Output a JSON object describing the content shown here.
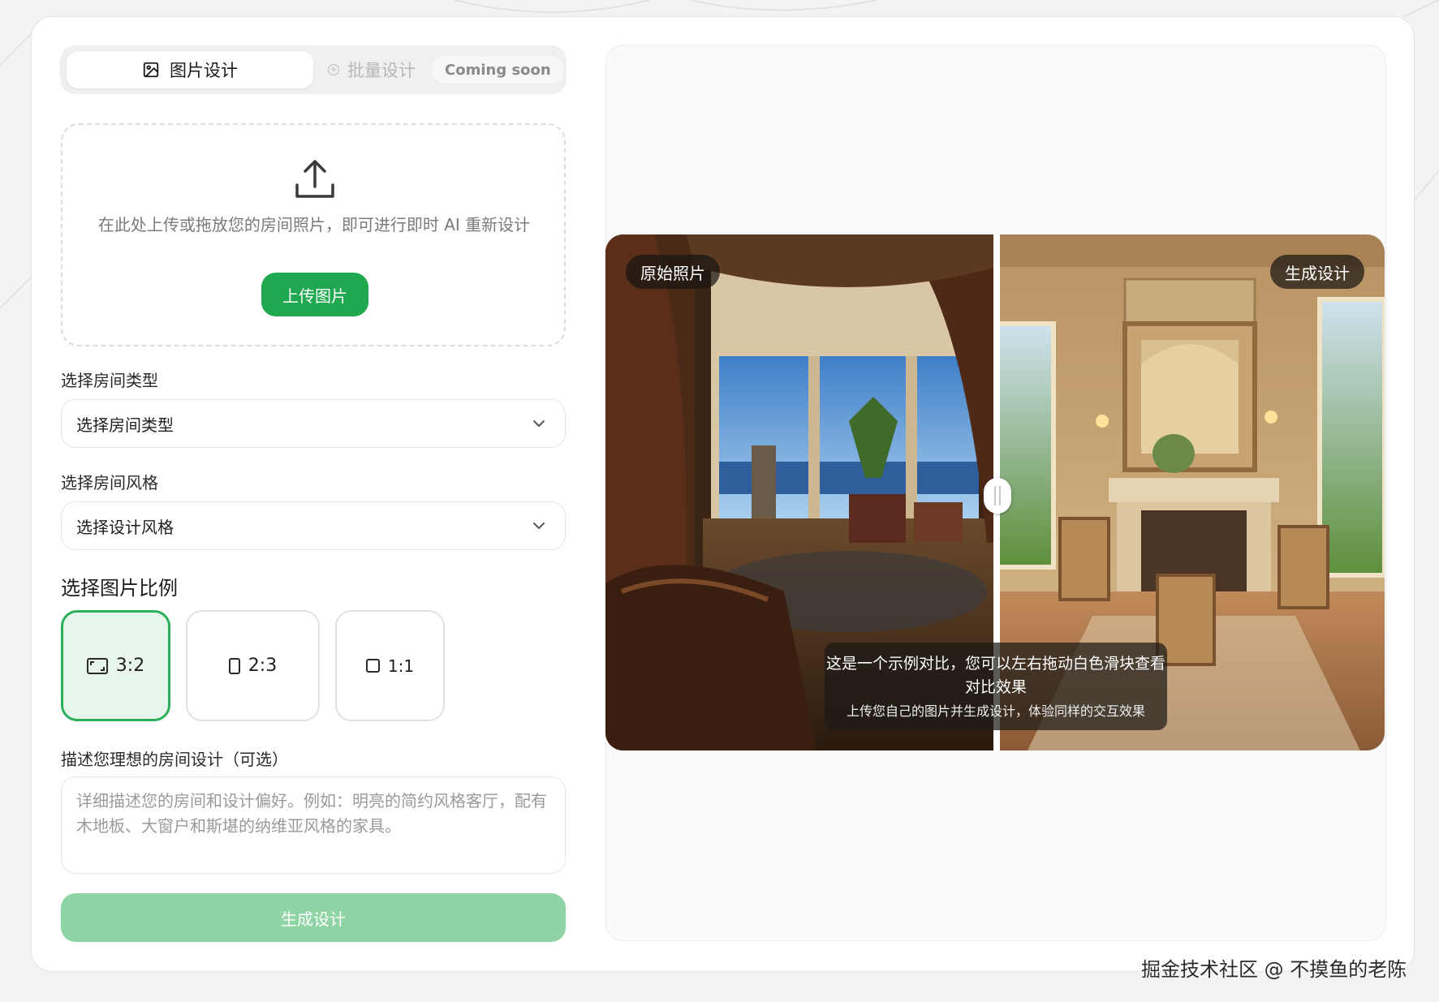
{
  "tabs": {
    "image_design": "图片设计",
    "batch_design": "批量设计",
    "coming_soon": "Coming soon"
  },
  "upload": {
    "hint": "在此处上传或拖放您的房间照片，即可进行即时 AI 重新设计",
    "button": "上传图片"
  },
  "room_type": {
    "label": "选择房间类型",
    "value": "选择房间类型"
  },
  "room_style": {
    "label": "选择房间风格",
    "value": "选择设计风格"
  },
  "ratio": {
    "label": "选择图片比例",
    "options": [
      "3:2",
      "2:3",
      "1:1"
    ],
    "selected": "3:2"
  },
  "description": {
    "label": "描述您理想的房间设计（可选）",
    "placeholder": "详细描述您的房间和设计偏好。例如：明亮的简约风格客厅，配有木地板、大窗户和斯堪的纳维亚风格的家具。"
  },
  "generate_button": "生成设计",
  "preview": {
    "original_badge": "原始照片",
    "generated_badge": "生成设计",
    "caption_line1": "这是一个示例对比，您可以左右拖动白色滑块查看对比效果",
    "caption_line2": "上传您自己的图片并生成设计，体验同样的交互效果"
  },
  "watermark": "掘金技术社区 @ 不摸鱼的老陈",
  "colors": {
    "accent": "#1fa84f",
    "accent_light": "#8fd4a4",
    "selected_bg": "#e8f5ec"
  }
}
